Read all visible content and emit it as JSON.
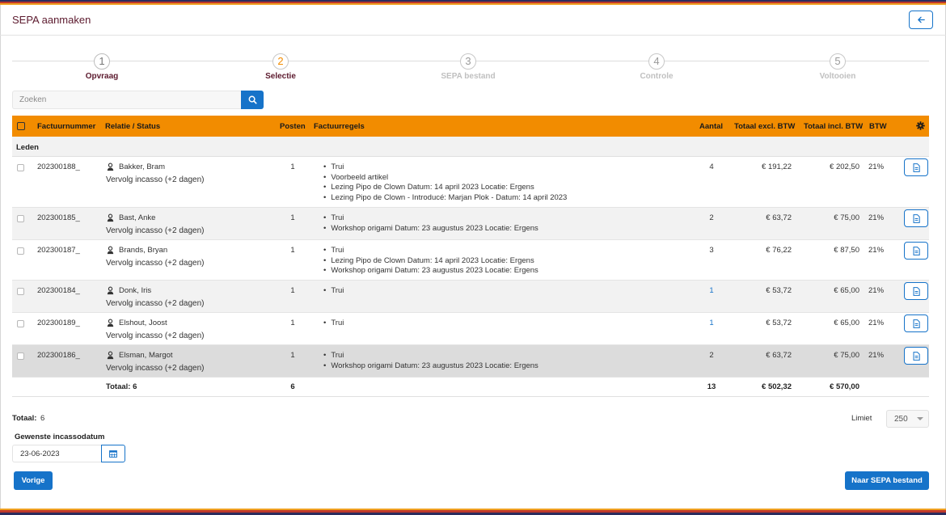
{
  "header": {
    "title": "SEPA aanmaken",
    "back_icon": "arrow-left-icon"
  },
  "steps": [
    {
      "number": "1",
      "label": "Opvraag",
      "state": "done"
    },
    {
      "number": "2",
      "label": "Selectie",
      "state": "active"
    },
    {
      "number": "3",
      "label": "SEPA bestand",
      "state": "pending"
    },
    {
      "number": "4",
      "label": "Controle",
      "state": "pending"
    },
    {
      "number": "5",
      "label": "Voltooien",
      "state": "pending"
    }
  ],
  "search": {
    "placeholder": "Zoeken",
    "value": ""
  },
  "colors": {
    "header_orange": "#f28c00",
    "primary_blue": "#1673c9",
    "title_maroon": "#5c1a2e"
  },
  "table": {
    "headers": {
      "factuurnummer": "Factuurnummer",
      "relatie": "Relatie / Status",
      "posten": "Posten",
      "factuurregels": "Factuurregels",
      "aantal": "Aantal",
      "excl": "Totaal excl. BTW",
      "incl": "Totaal incl. BTW",
      "btw": "BTW"
    },
    "group": "Leden",
    "rows": [
      {
        "nr": "202300188_",
        "name": "Bakker, Bram",
        "status": "Vervolg incasso (+2 dagen)",
        "posten": "1",
        "lines": [
          "Trui",
          "Voorbeeld artikel",
          "Lezing Pipo de Clown Datum: 14 april 2023 Locatie: Ergens",
          "Lezing Pipo de Clown - Introducé: Marjan Plok - Datum: 14 april 2023"
        ],
        "aantal": "4",
        "excl": "€ 191,22",
        "incl": "€ 202,50",
        "btw": "21%"
      },
      {
        "nr": "202300185_",
        "name": "Bast, Anke",
        "status": "Vervolg incasso (+2 dagen)",
        "posten": "1",
        "lines": [
          "Trui",
          "Workshop origami Datum: 23 augustus 2023 Locatie: Ergens"
        ],
        "aantal": "2",
        "excl": "€ 63,72",
        "incl": "€ 75,00",
        "btw": "21%"
      },
      {
        "nr": "202300187_",
        "name": "Brands, Bryan",
        "status": "Vervolg incasso (+2 dagen)",
        "posten": "1",
        "lines": [
          "Trui",
          "Lezing Pipo de Clown Datum: 14 april 2023 Locatie: Ergens",
          "Workshop origami Datum: 23 augustus 2023 Locatie: Ergens"
        ],
        "aantal": "3",
        "excl": "€ 76,22",
        "incl": "€ 87,50",
        "btw": "21%"
      },
      {
        "nr": "202300184_",
        "name": "Donk, Iris",
        "status": "Vervolg incasso (+2 dagen)",
        "posten": "1",
        "lines": [
          "Trui"
        ],
        "aantal": "1",
        "excl": "€ 53,72",
        "incl": "€ 65,00",
        "btw": "21%"
      },
      {
        "nr": "202300189_",
        "name": "Elshout, Joost",
        "status": "Vervolg incasso (+2 dagen)",
        "posten": "1",
        "lines": [
          "Trui"
        ],
        "aantal": "1",
        "excl": "€ 53,72",
        "incl": "€ 65,00",
        "btw": "21%"
      },
      {
        "nr": "202300186_",
        "name": "Elsman, Margot",
        "status": "Vervolg incasso (+2 dagen)",
        "posten": "1",
        "lines": [
          "Trui",
          "Workshop origami Datum: 23 augustus 2023 Locatie: Ergens"
        ],
        "aantal": "2",
        "excl": "€ 63,72",
        "incl": "€ 75,00",
        "btw": "21%"
      }
    ],
    "totals": {
      "label": "Totaal: 6",
      "posten": "6",
      "aantal": "13",
      "excl": "€ 502,32",
      "incl": "€ 570,00"
    }
  },
  "summary": {
    "label": "Totaal:",
    "value": "6"
  },
  "limit": {
    "label": "Limiet",
    "value": "250"
  },
  "date": {
    "label": "Gewenste incassodatum",
    "value": "23-06-2023"
  },
  "buttons": {
    "prev": "Vorige",
    "next": "Naar SEPA bestand"
  }
}
